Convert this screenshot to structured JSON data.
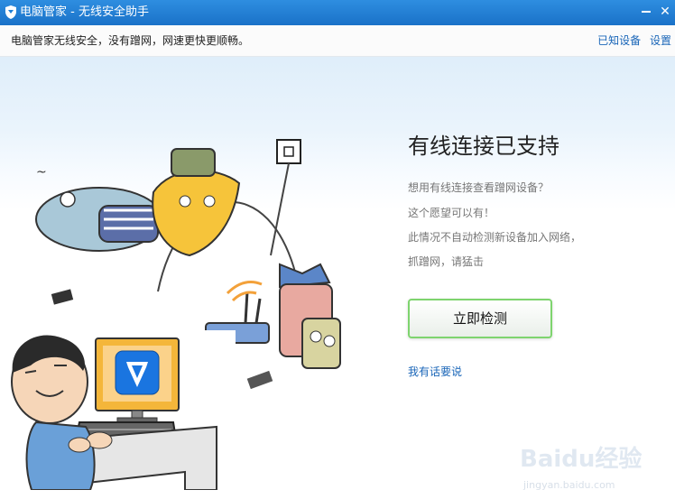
{
  "titlebar": {
    "app_name": "电脑管家",
    "separator": " - ",
    "window_title": "无线安全助手",
    "icons": [
      "shield-logo-icon",
      "minimize-icon",
      "close-icon"
    ]
  },
  "notice": {
    "message": "电脑管家无线安全，没有蹭网，网速更快更顺畅。",
    "known_devices_link": "已知设备",
    "settings_link": "设置"
  },
  "content": {
    "heading": "有线连接已支持",
    "lines": [
      "想用有线连接查看蹭网设备？",
      "这个愿望可以有！",
      "此情况不自动检测新设备加入网络，",
      "抓蹭网，请猛击"
    ],
    "scan_button": "立即检测",
    "feedback_link": "我有话要说"
  },
  "watermark": {
    "brand": "Baidu经验",
    "url": "jingyan.baidu.com"
  },
  "colors": {
    "titlebar": "#1f7fd6",
    "link": "#1a66b8",
    "button_border": "#7ed46e",
    "shield": "#1a75e0"
  }
}
